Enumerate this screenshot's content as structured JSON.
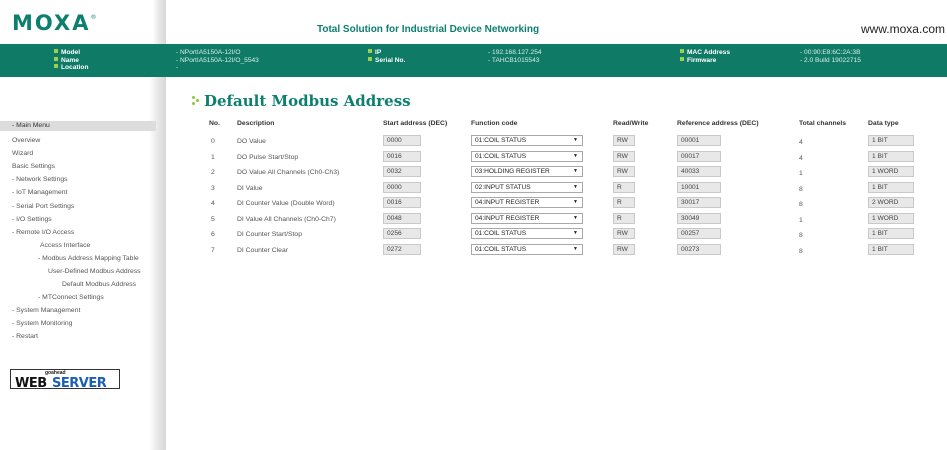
{
  "header": {
    "logo": "MOXA",
    "logo_mark": "®",
    "tagline": "Total Solution for Industrial Device Networking",
    "site": "www.moxa.com"
  },
  "info": {
    "model_label": "Model",
    "name_label": "Name",
    "location_label": "Location",
    "model_value": "- NPortIA5150A-12I/O",
    "name_value": "- NPortIA5150A-12I/O_5543",
    "location_value": "-",
    "ip_label": "IP",
    "serial_label": "Serial No.",
    "ip_value": "- 192.168.127.254",
    "serial_value": "- TAHCB1015543",
    "mac_label": "MAC Address",
    "firmware_label": "Firmware",
    "mac_value": "- 00:90:E8:6C:2A:3B",
    "firmware_value": "- 2.0 Build 19022715"
  },
  "sidebar": {
    "head": "- Main Menu",
    "items": [
      "Overview",
      "Wizard",
      "Basic Settings",
      "- Network Settings",
      "- IoT Management",
      "- Serial Port Settings",
      "- I/O Settings",
      "- Remote I/O Access",
      "Access Interface",
      "- Modbus Address Mapping Table",
      "User-Defined Modbus Address",
      "Default Modbus Address",
      "- MTConnect Settings",
      "- System Management",
      "- System Monitoring",
      "- Restart"
    ],
    "badge_small": "goahead",
    "badge_web": "WEB",
    "badge_server": "SERVER"
  },
  "page": {
    "title": "Default Modbus Address"
  },
  "table": {
    "headers": [
      "No.",
      "Description",
      "Start address (DEC)",
      "Function code",
      "Read/Write",
      "Reference address (DEC)",
      "Total channels",
      "Data type"
    ],
    "rows": [
      {
        "no": "0",
        "desc": "DO Value",
        "start": "0000",
        "func": "01:COIL STATUS",
        "rw": "RW",
        "ref": "00001",
        "total": "4",
        "type": "1 BIT"
      },
      {
        "no": "1",
        "desc": "DO Pulse Start/Stop",
        "start": "0016",
        "func": "01:COIL STATUS",
        "rw": "RW",
        "ref": "00017",
        "total": "4",
        "type": "1 BIT"
      },
      {
        "no": "2",
        "desc": "DO Value All Channels (Ch0-Ch3)",
        "start": "0032",
        "func": "03:HOLDING REGISTER",
        "rw": "RW",
        "ref": "40033",
        "total": "1",
        "type": "1 WORD"
      },
      {
        "no": "3",
        "desc": "DI Value",
        "start": "0000",
        "func": "02:INPUT STATUS",
        "rw": "R",
        "ref": "10001",
        "total": "8",
        "type": "1 BIT"
      },
      {
        "no": "4",
        "desc": "DI Counter Value (Double Word)",
        "start": "0016",
        "func": "04:INPUT REGISTER",
        "rw": "R",
        "ref": "30017",
        "total": "8",
        "type": "2 WORD"
      },
      {
        "no": "5",
        "desc": "DI Value All Channels (Ch0-Ch7)",
        "start": "0048",
        "func": "04:INPUT REGISTER",
        "rw": "R",
        "ref": "30049",
        "total": "1",
        "type": "1 WORD"
      },
      {
        "no": "6",
        "desc": "DI Counter Start/Stop",
        "start": "0256",
        "func": "01:COIL STATUS",
        "rw": "RW",
        "ref": "00257",
        "total": "8",
        "type": "1 BIT"
      },
      {
        "no": "7",
        "desc": "DI Counter Clear",
        "start": "0272",
        "func": "01:COIL STATUS",
        "rw": "RW",
        "ref": "00273",
        "total": "8",
        "type": "1 BIT"
      }
    ]
  },
  "colors": {
    "brand": "#0d7f6f",
    "infobar": "#0f7b67",
    "bullet": "#9ccf4b"
  }
}
